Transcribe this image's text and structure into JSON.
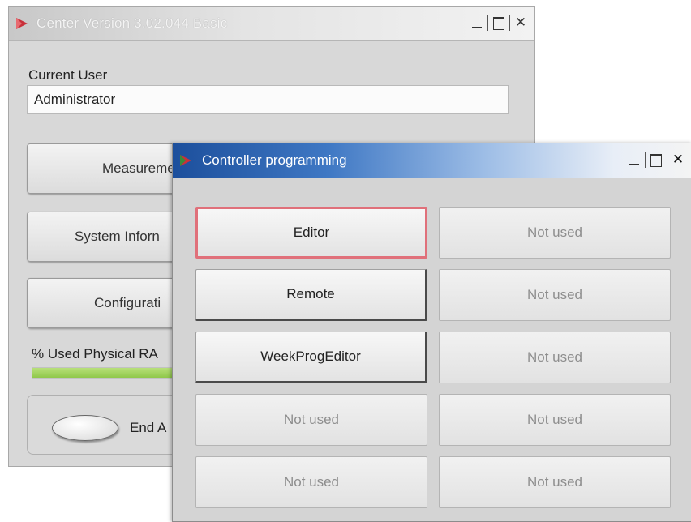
{
  "back_window": {
    "title": "Center Version 3.02.044  Basic",
    "current_user_label": "Current User",
    "current_user_value": "Administrator",
    "buttons": {
      "measurement": "Measurement  M",
      "system_information": "System Inforn",
      "configuration": "Configurati"
    },
    "ram_label": "% Used Physical RA",
    "ram_used_fraction": 0.3,
    "end_label": "End A"
  },
  "front_window": {
    "title": "Controller programming",
    "buttons": [
      {
        "label": "Editor",
        "state": "selected"
      },
      {
        "label": "Not used",
        "state": "disabled"
      },
      {
        "label": "Remote",
        "state": "active"
      },
      {
        "label": "Not used",
        "state": "disabled"
      },
      {
        "label": "WeekProgEditor",
        "state": "active"
      },
      {
        "label": "Not used",
        "state": "disabled"
      },
      {
        "label": "Not used",
        "state": "disabled"
      },
      {
        "label": "Not used",
        "state": "disabled"
      },
      {
        "label": "Not used",
        "state": "disabled"
      },
      {
        "label": "Not used",
        "state": "disabled"
      }
    ]
  },
  "colors": {
    "selected_outline": "#e0707a",
    "ram_bar": "#8fc84a",
    "front_titlebar": "#1c4f9c"
  }
}
